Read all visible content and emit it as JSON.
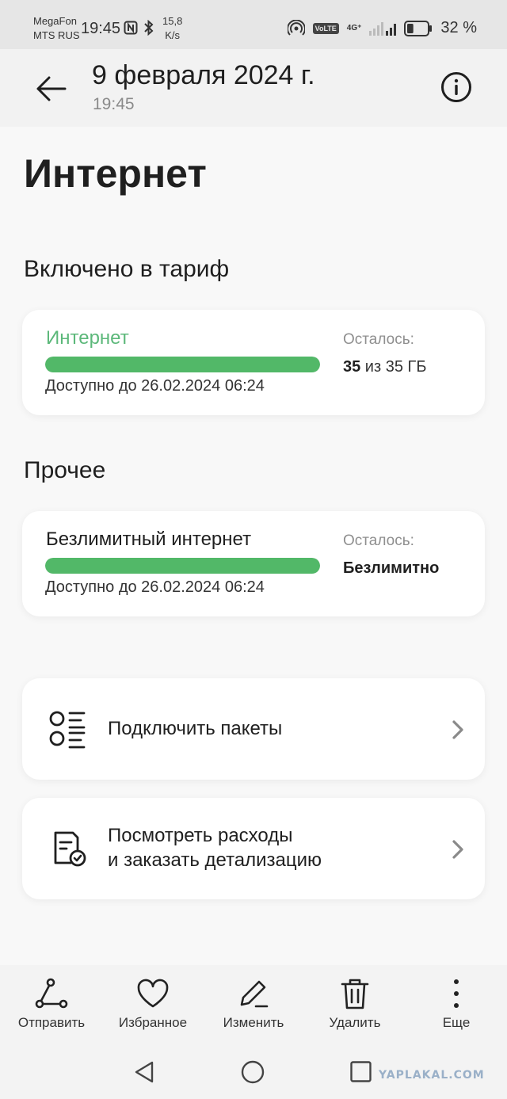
{
  "status_bar": {
    "carrier_1": "MegaFon",
    "carrier_2": "MTS RUS",
    "time": "19:45",
    "speed_value": "15,8",
    "speed_unit": "K/s",
    "battery_pct": "32 %",
    "battery_level": 0.32,
    "volte": "VoLTE",
    "network": "4G⁺"
  },
  "header": {
    "title": "9 февраля 2024 г.",
    "subtitle": "19:45"
  },
  "page": {
    "title": "Интернет"
  },
  "sections": {
    "included": {
      "title": "Включено в тариф",
      "card": {
        "name": "Интернет",
        "progress": 1.0,
        "available": "Доступно до 26.02.2024 06:24",
        "remaining_label": "Осталось:",
        "remaining_amount": "35",
        "remaining_rest": " из 35 ГБ"
      }
    },
    "other": {
      "title": "Прочее",
      "card": {
        "name": "Безлимитный интернет",
        "progress": 1.0,
        "available": "Доступно до 26.02.2024 06:24",
        "remaining_label": "Осталось:",
        "remaining_value": "Безлимитно"
      }
    }
  },
  "actions": [
    {
      "label": "Подключить пакеты",
      "icon": "list-icon"
    },
    {
      "line1": "Посмотреть расходы",
      "line2": "и заказать детализацию",
      "icon": "document-check-icon"
    }
  ],
  "toolbar": {
    "send": "Отправить",
    "favorite": "Избранное",
    "edit": "Изменить",
    "delete": "Удалить",
    "more": "Еще"
  },
  "watermark": "YAPLAKAL.COM",
  "colors": {
    "accent_green": "#52b868",
    "name_green": "#5cb87a",
    "watermark": "#9ab0c8"
  }
}
